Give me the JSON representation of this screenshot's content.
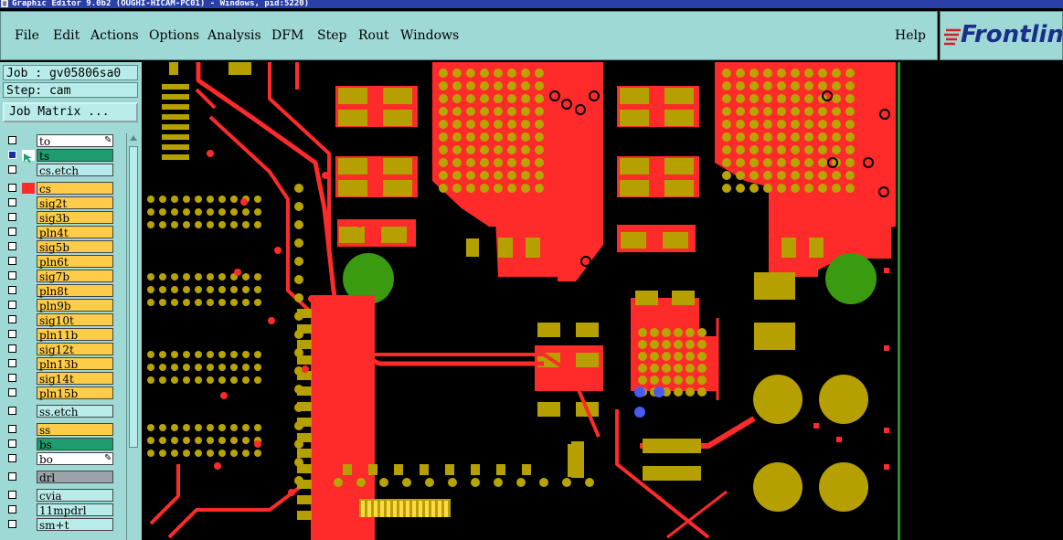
{
  "window": {
    "title": "Graphic Editor 9.0b2 (OUGHI-HICAM-PC01) - Windows, pid:5220)"
  },
  "menu": {
    "file": "File",
    "edit": "Edit",
    "actions": "Actions",
    "options": "Options",
    "analysis": "Analysis",
    "dfm": "DFM",
    "step": "Step",
    "rout": "Rout",
    "windows": "Windows",
    "help": "Help"
  },
  "brand": {
    "logo_text": "Frontline",
    "color": "#1a2e8a",
    "mark_color": "#d81e1e"
  },
  "job": {
    "job_label": "Job : gv05806sa0",
    "step_label": "Step: cam",
    "matrix_button": "Job Matrix ..."
  },
  "layers": [
    {
      "name": "to",
      "color": "#ffffff",
      "checked": false
    },
    {
      "name": "ts",
      "color": "#1e9e6e",
      "checked": true
    },
    {
      "name": "cs.etch",
      "color": "#b8ecea",
      "checked": false
    },
    {
      "name": "cs",
      "color": "#ffcc4a",
      "checked": false
    },
    {
      "name": "sig2t",
      "color": "#ffcc4a",
      "checked": false
    },
    {
      "name": "sig3b",
      "color": "#ffcc4a",
      "checked": false
    },
    {
      "name": "pln4t",
      "color": "#ffcc4a",
      "checked": false
    },
    {
      "name": "sig5b",
      "color": "#ffcc4a",
      "checked": false
    },
    {
      "name": "pln6t",
      "color": "#ffcc4a",
      "checked": false
    },
    {
      "name": "sig7b",
      "color": "#ffcc4a",
      "checked": false
    },
    {
      "name": "pln8t",
      "color": "#ffcc4a",
      "checked": false
    },
    {
      "name": "pln9b",
      "color": "#ffcc4a",
      "checked": false
    },
    {
      "name": "sig10t",
      "color": "#ffcc4a",
      "checked": false
    },
    {
      "name": "pln11b",
      "color": "#ffcc4a",
      "checked": false
    },
    {
      "name": "sig12t",
      "color": "#ffcc4a",
      "checked": false
    },
    {
      "name": "pln13b",
      "color": "#ffcc4a",
      "checked": false
    },
    {
      "name": "sig14t",
      "color": "#ffcc4a",
      "checked": false
    },
    {
      "name": "pln15b",
      "color": "#ffcc4a",
      "checked": false
    },
    {
      "name": "ss.etch",
      "color": "#b8ecea",
      "checked": false
    },
    {
      "name": "ss",
      "color": "#ffcc4a",
      "checked": false
    },
    {
      "name": "bs",
      "color": "#1e9e6e",
      "checked": false
    },
    {
      "name": "bo",
      "color": "#ffffff",
      "checked": false
    },
    {
      "name": "drl",
      "color": "#9aa4a8",
      "checked": false
    },
    {
      "name": "cvia",
      "color": "#b8ecea",
      "checked": false
    },
    {
      "name": "11mpdrl",
      "color": "#b8ecea",
      "checked": false
    },
    {
      "name": "sm+t",
      "color": "#b8ecea",
      "checked": false
    }
  ],
  "colors": {
    "copper": "#ff2a2a",
    "pad": "#b5a000",
    "via_ring": "#b8a400",
    "pin": "#ffd84a",
    "mounting_hole": "#3a9a10",
    "highlight": "#4a5cf0",
    "ui_bg": "#9fd9d6",
    "board_edge": "#2d8a2d"
  }
}
